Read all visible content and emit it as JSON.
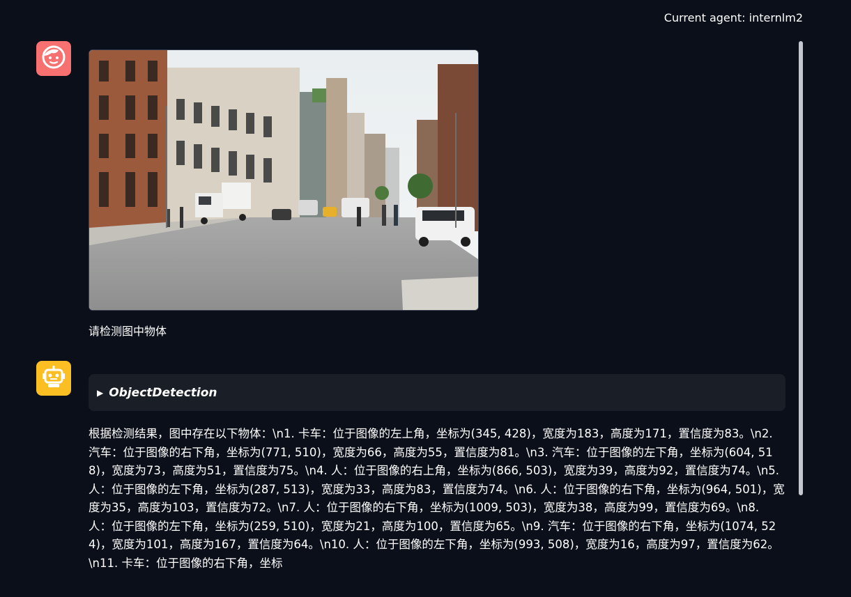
{
  "header": {
    "agent_label": "Current agent: internlm2"
  },
  "icons": {
    "user": "face-icon",
    "bot": "robot-icon"
  },
  "colors": {
    "background": "#0b0f19",
    "user_avatar": "#f87171",
    "bot_avatar": "#fbbf24",
    "details_bg": "#1a1f27"
  },
  "messages": {
    "user": {
      "image": "street-photo",
      "text": "请检测图中物体"
    },
    "bot": {
      "tool_label": "ObjectDetection",
      "answer": "根据检测结果，图中存在以下物体：\\n1. 卡车：位于图像的左上角，坐标为(345, 428)，宽度为183，高度为171，置信度为83。\\n2. 汽车：位于图像的右下角，坐标为(771, 510)，宽度为66，高度为55，置信度为81。\\n3. 汽车：位于图像的左下角，坐标为(604, 518)，宽度为73，高度为51，置信度为75。\\n4. 人：位于图像的右上角，坐标为(866, 503)，宽度为39，高度为92，置信度为74。\\n5. 人：位于图像的左下角，坐标为(287, 513)，宽度为33，高度为83，置信度为74。\\n6. 人：位于图像的右下角，坐标为(964, 501)，宽度为35，高度为103，置信度为72。\\n7. 人：位于图像的右下角，坐标为(1009, 503)，宽度为38，高度为99，置信度为69。\\n8. 人：位于图像的左下角，坐标为(259, 510)，宽度为21，高度为100，置信度为65。\\n9. 汽车：位于图像的右下角，坐标为(1074, 524)，宽度为101，高度为167，置信度为64。\\n10. 人：位于图像的左下角，坐标为(993, 508)，宽度为16，高度为97，置信度为62。\\n11. 卡车：位于图像的右下角，坐标"
    }
  }
}
